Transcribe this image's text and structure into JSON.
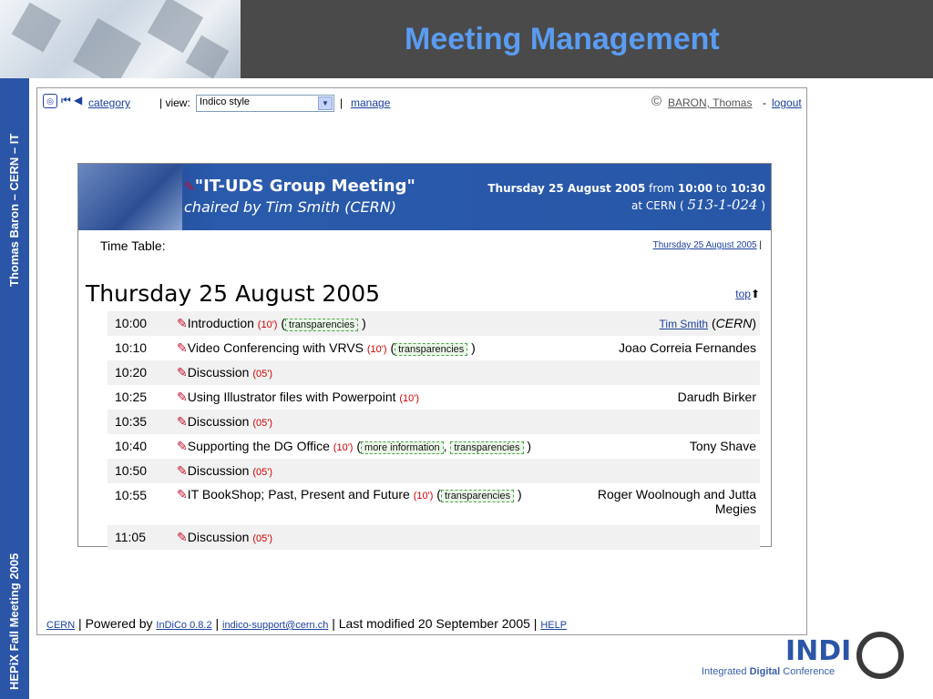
{
  "slide": {
    "title": "Meeting Management",
    "side_top": "Thomas Baron – CERN – IT",
    "side_bottom": "HEPiX Fall Meeting 2005"
  },
  "nav": {
    "category": "category",
    "view_label": "| view:",
    "view_value": "Indico style",
    "manage": "manage",
    "user": "BARON, Thomas",
    "logout": "logout"
  },
  "meeting": {
    "title": "\"IT-UDS Group Meeting\"",
    "chair_prefix": "chaired by",
    "chair": "Tim Smith (CERN)",
    "date": "Thursday 25 August 2005",
    "from_label": "from",
    "start": "10:00",
    "to_label": "to",
    "end": "10:30",
    "at_label": "at CERN (",
    "room": "513-1-024",
    "at_close": ")"
  },
  "timetable": {
    "label": "Time Table:",
    "date_link": "Thursday 25 August 2005",
    "day_heading": "Thursday 25 August 2005",
    "top_link": "top",
    "rows": [
      {
        "time": "10:00",
        "title": "Introduction",
        "dur": "(10')",
        "mats": [
          "transparencies"
        ],
        "speaker": "Tim Smith",
        "affil": "CERN"
      },
      {
        "time": "10:10",
        "title": "Video Conferencing with VRVS",
        "dur": "(10')",
        "mats": [
          "transparencies"
        ],
        "speaker": "Joao Correia Fernandes"
      },
      {
        "time": "10:20",
        "title": "Discussion",
        "dur": "(05')",
        "mats": [],
        "speaker": ""
      },
      {
        "time": "10:25",
        "title": "Using Illustrator files with Powerpoint",
        "dur": "(10')",
        "mats": [],
        "speaker": "Darudh Birker"
      },
      {
        "time": "10:35",
        "title": "Discussion",
        "dur": "(05')",
        "mats": [],
        "speaker": ""
      },
      {
        "time": "10:40",
        "title": "Supporting the DG Office",
        "dur": "(10')",
        "mats": [
          "more information",
          "transparencies"
        ],
        "speaker": "Tony Shave"
      },
      {
        "time": "10:50",
        "title": "Discussion",
        "dur": "(05')",
        "mats": [],
        "speaker": ""
      },
      {
        "time": "10:55",
        "title": "IT BookShop; Past, Present and Future",
        "dur": "(10')",
        "mats": [
          "transparencies"
        ],
        "speaker": "Roger Woolnough and Jutta Megies"
      },
      {
        "time": "11:05",
        "title": "Discussion",
        "dur": "(05')",
        "mats": [],
        "speaker": ""
      }
    ]
  },
  "footer": {
    "cern": "CERN",
    "powered": "Powered by",
    "indico": "InDiCo 0.8.2",
    "support": "indico-support@cern.ch",
    "modified": "Last modified 20 September 2005",
    "help": "HELP"
  },
  "logo": {
    "name": "INDI",
    "tagline_a": "Integrated",
    "tagline_b": "Digital",
    "tagline_c": "Conference"
  }
}
